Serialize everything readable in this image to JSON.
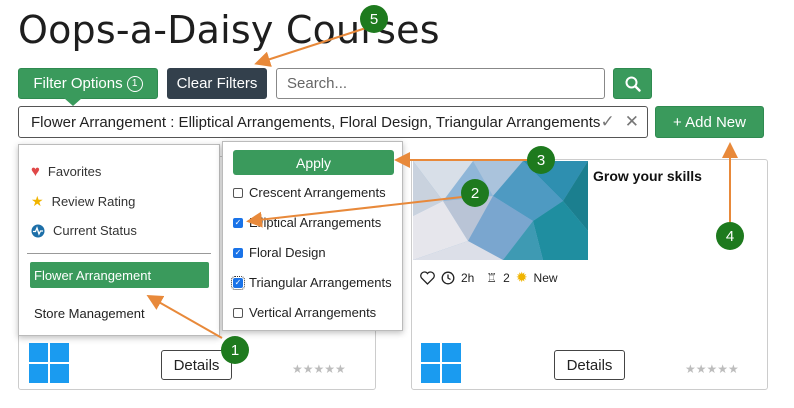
{
  "header": {
    "title": "Oops-a-Daisy Courses"
  },
  "toolbar": {
    "filter_label": "Filter Options",
    "filter_count": "1",
    "clear_label": "Clear Filters",
    "search_placeholder": "Search...",
    "add_label": "+ Add New"
  },
  "tag_field": {
    "value": "Flower Arrangement : Elliptical Arrangements, Floral Design, Triangular Arrangements",
    "confirm_glyph": "✓",
    "clear_glyph": "✕"
  },
  "filter_menu": {
    "items": [
      {
        "label": "Favorites",
        "icon": "heart-icon",
        "color": "#e04848"
      },
      {
        "label": "Review Rating",
        "icon": "star-icon",
        "color": "#f0b400"
      },
      {
        "label": "Current Status",
        "icon": "pulse-icon",
        "color": "#1d6fa8"
      }
    ],
    "active": "Flower Arrangement",
    "store": "Store Management"
  },
  "sub_menu": {
    "apply_label": "Apply",
    "options": [
      {
        "label": "Crescent Arrangements",
        "checked": false
      },
      {
        "label": "Elliptical Arrangements",
        "checked": true
      },
      {
        "label": "Floral Design",
        "checked": true
      },
      {
        "label": "Triangular Arrangements",
        "checked": true
      },
      {
        "label": "Vertical Arrangements",
        "checked": false
      }
    ]
  },
  "cards": {
    "left": {
      "details_label": "Details",
      "stars": "★★★★★"
    },
    "right": {
      "title": "Grow your skills",
      "duration": "2h",
      "level": "2",
      "status": "New",
      "details_label": "Details",
      "stars": "★★★★★"
    }
  },
  "callouts": [
    "1",
    "2",
    "3",
    "4",
    "5"
  ],
  "colors": {
    "accent": "#3a9a5c",
    "dark": "#33404c",
    "callout": "#1e7a1e",
    "arrow": "#e8893a",
    "windows": "#1a9bf0"
  }
}
